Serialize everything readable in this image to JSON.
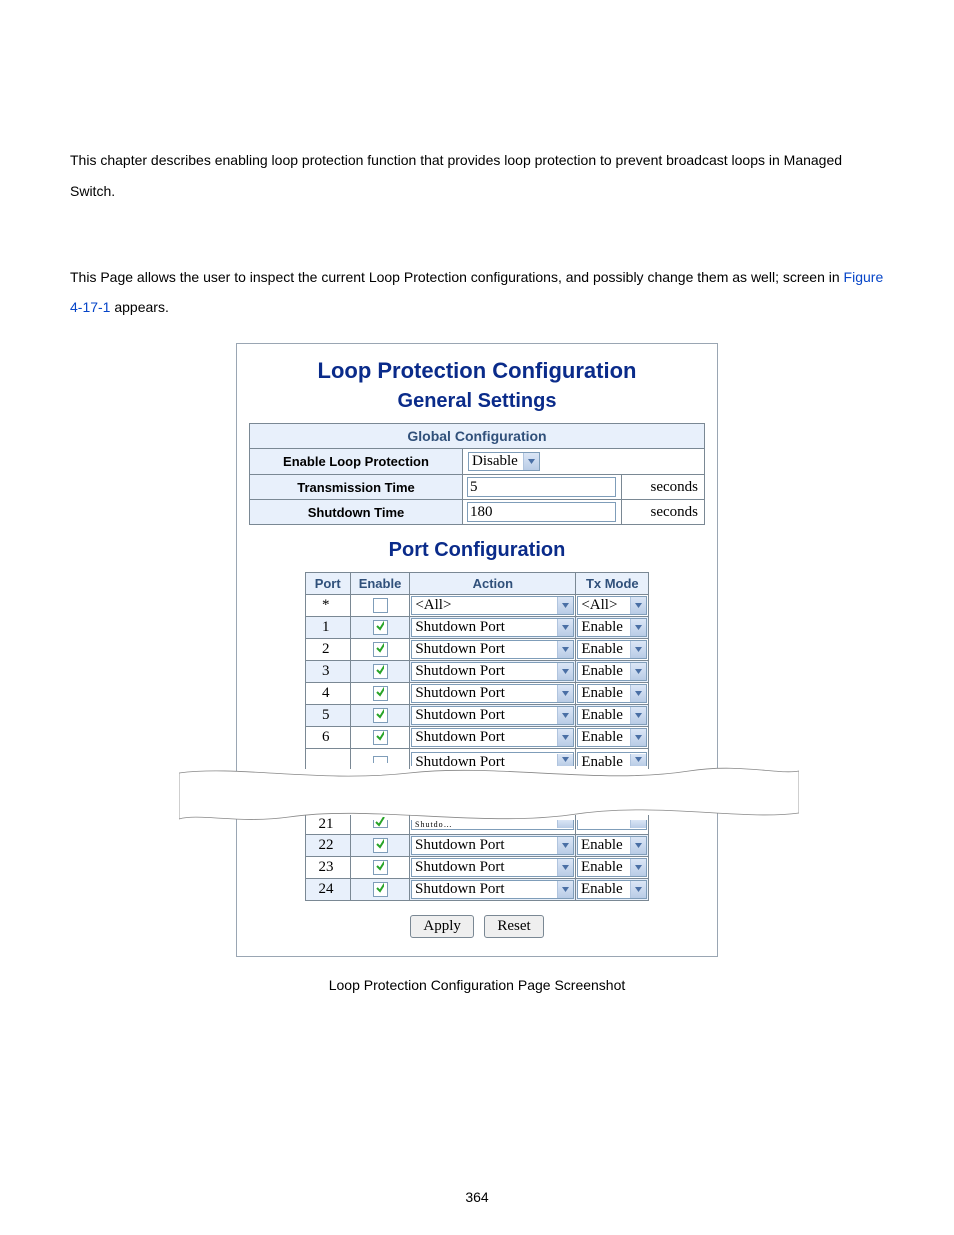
{
  "intro_text": "This chapter describes enabling loop protection function that provides loop protection to prevent broadcast loops in Managed Switch.",
  "intro2_prefix": "This Page allows the user to inspect the current Loop Protection configurations, and possibly change them as well; screen in ",
  "intro2_link": "Figure 4-17-1",
  "intro2_suffix": " appears.",
  "panel": {
    "title": "Loop Protection Configuration",
    "sub_general": "General Settings",
    "sub_port": "Port Configuration",
    "global_header": "Global Configuration",
    "rows": {
      "enable_label": "Enable Loop Protection",
      "enable_value": "Disable",
      "tx_label": "Transmission Time",
      "tx_value": "5",
      "tx_unit": "seconds",
      "sd_label": "Shutdown Time",
      "sd_value": "180",
      "sd_unit": "seconds"
    },
    "port_headers": {
      "port": "Port",
      "enable": "Enable",
      "action": "Action",
      "txmode": "Tx Mode"
    },
    "ports_top": [
      {
        "port": "*",
        "enable": false,
        "action": "<All>",
        "txmode": "<All>"
      },
      {
        "port": "1",
        "enable": true,
        "action": "Shutdown Port",
        "txmode": "Enable"
      },
      {
        "port": "2",
        "enable": true,
        "action": "Shutdown Port",
        "txmode": "Enable"
      },
      {
        "port": "3",
        "enable": true,
        "action": "Shutdown Port",
        "txmode": "Enable"
      },
      {
        "port": "4",
        "enable": true,
        "action": "Shutdown Port",
        "txmode": "Enable"
      },
      {
        "port": "5",
        "enable": true,
        "action": "Shutdown Port",
        "txmode": "Enable"
      },
      {
        "port": "6",
        "enable": true,
        "action": "Shutdown Port",
        "txmode": "Enable"
      }
    ],
    "port7_action_partial": "Shutdown Port",
    "port7_txmode": "Enable",
    "port21_partial": "21",
    "ports_bottom": [
      {
        "port": "22",
        "enable": true,
        "action": "Shutdown Port",
        "txmode": "Enable"
      },
      {
        "port": "23",
        "enable": true,
        "action": "Shutdown Port",
        "txmode": "Enable"
      },
      {
        "port": "24",
        "enable": true,
        "action": "Shutdown Port",
        "txmode": "Enable"
      }
    ],
    "buttons": {
      "apply": "Apply",
      "reset": "Reset"
    }
  },
  "caption": "Loop Protection Configuration Page Screenshot",
  "page_number": "364"
}
